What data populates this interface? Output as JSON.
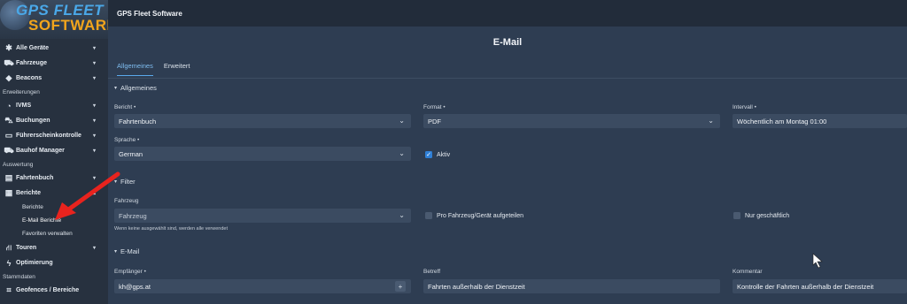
{
  "logo": {
    "line1": "GPS FLEET",
    "line2": "SOFTWARE"
  },
  "app_title": "GPS Fleet Software",
  "sidebar": {
    "items": [
      {
        "type": "item",
        "label": "Alle Geräte",
        "icon": "asterisk-icon",
        "chev": "▾"
      },
      {
        "type": "item",
        "label": "Fahrzeuge",
        "icon": "truck-icon",
        "chev": "▾"
      },
      {
        "type": "item",
        "label": "Beacons",
        "icon": "tag-icon",
        "chev": "▾"
      },
      {
        "type": "section",
        "label": "Erweiterungen"
      },
      {
        "type": "item",
        "label": "IVMS",
        "icon": "speedometer-icon",
        "chev": "▾"
      },
      {
        "type": "item",
        "label": "Buchungen",
        "icon": "car-icon",
        "chev": "▾"
      },
      {
        "type": "item",
        "label": "Führerscheinkontrolle",
        "icon": "id-card-icon",
        "chev": "▾"
      },
      {
        "type": "item",
        "label": "Bauhof Manager",
        "icon": "truck-icon",
        "chev": "▾"
      },
      {
        "type": "section",
        "label": "Auswertung"
      },
      {
        "type": "item",
        "label": "Fahrtenbuch",
        "icon": "book-icon",
        "chev": "▾"
      },
      {
        "type": "item",
        "label": "Berichte",
        "icon": "document-icon",
        "chev": "▴"
      },
      {
        "type": "sub",
        "label": "Berichte"
      },
      {
        "type": "sub",
        "label": "E-Mail Berichte",
        "active": true
      },
      {
        "type": "sub",
        "label": "Favoriten verwalten"
      },
      {
        "type": "item",
        "label": "Touren",
        "icon": "road-icon",
        "chev": "▾"
      },
      {
        "type": "item",
        "label": "Optimierung",
        "icon": "bolt-icon",
        "chev": ""
      },
      {
        "type": "section",
        "label": "Stammdaten"
      },
      {
        "type": "item",
        "label": "Geofences / Bereiche",
        "icon": "geofence-icon",
        "chev": ""
      }
    ]
  },
  "page_title": "E-Mail",
  "tabs": [
    {
      "label": "Allgemeines",
      "active": true
    },
    {
      "label": "Erweitert",
      "active": false
    }
  ],
  "sections": {
    "allgemeines": "Allgemeines",
    "filter": "Filter",
    "email": "E-Mail"
  },
  "form": {
    "bericht": {
      "label": "Bericht •",
      "value": "Fahrtenbuch"
    },
    "format": {
      "label": "Format •",
      "value": "PDF"
    },
    "intervall": {
      "label": "Intervall •",
      "value": "Wöchentlich am Montag 01:00"
    },
    "sprache": {
      "label": "Sprache •",
      "value": "German"
    },
    "aktiv": {
      "label": "Aktiv",
      "checked": true
    },
    "fahrzeug": {
      "label": "Fahrzeug",
      "placeholder": "Fahrzeug",
      "hint": "Wenn keine ausgewählt sind, werden alle verwendet"
    },
    "pro_fahrzeug": {
      "label": "Pro Fahrzeug/Gerät aufgeteilen",
      "checked": false
    },
    "nur_geschaeftlich": {
      "label": "Nur geschäftlich",
      "checked": false
    },
    "empfaenger": {
      "label": "Empfänger •",
      "value": "kh@gps.at",
      "plus": "+"
    },
    "betreff": {
      "label": "Betreff",
      "value": "Fahrten außerhalb der Dienstzeit"
    },
    "kommentar": {
      "label": "Kommentar",
      "value": "Kontrolle der Fahrten außerhalb der Dienstzeit"
    }
  },
  "colors": {
    "accent": "#5aa9ec",
    "annotation_arrow": "#e8231e"
  }
}
